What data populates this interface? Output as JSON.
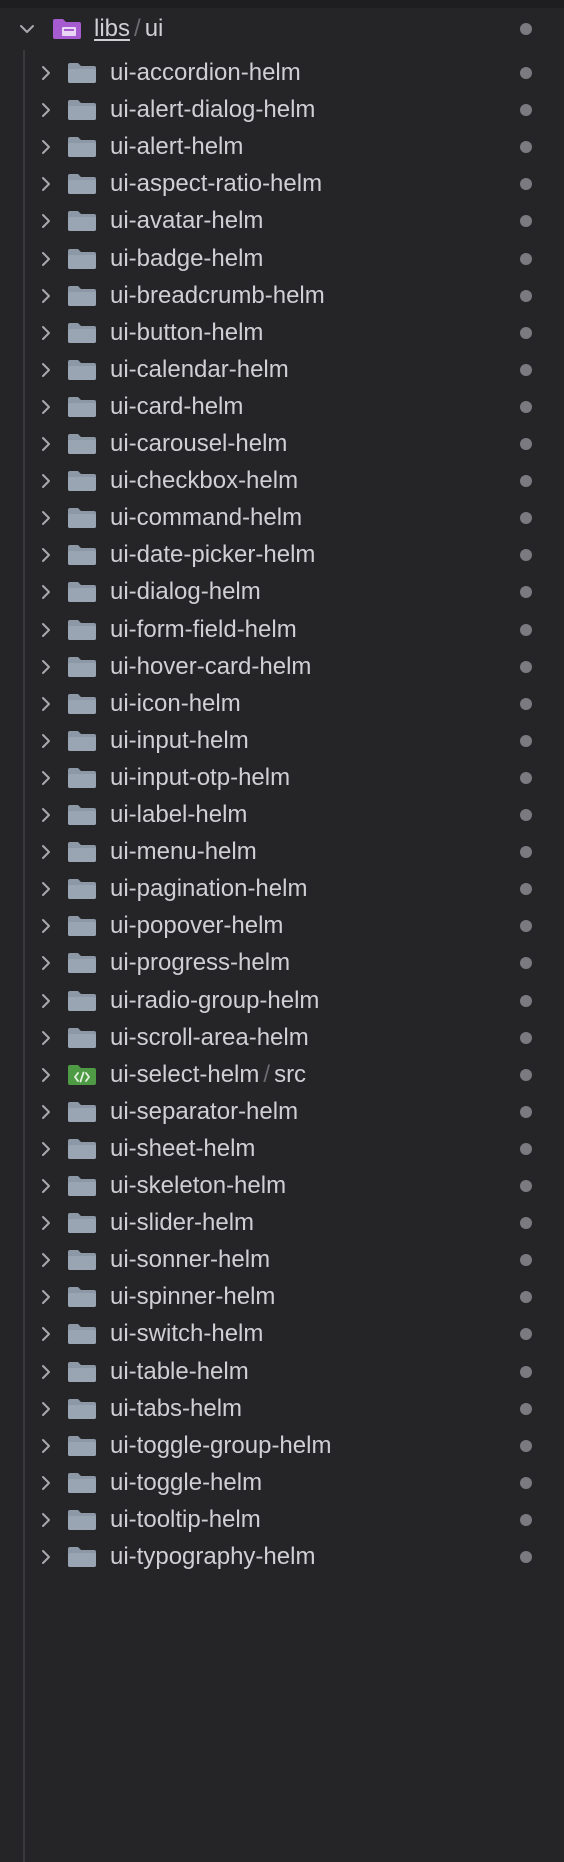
{
  "root": {
    "name": "libs",
    "subpath": "ui",
    "separator": "/",
    "expanded": true,
    "icon": "purple-folder-icon"
  },
  "items": [
    {
      "label": "ui-accordion-helm",
      "icon": "folder-icon"
    },
    {
      "label": "ui-alert-dialog-helm",
      "icon": "folder-icon"
    },
    {
      "label": "ui-alert-helm",
      "icon": "folder-icon"
    },
    {
      "label": "ui-aspect-ratio-helm",
      "icon": "folder-icon"
    },
    {
      "label": "ui-avatar-helm",
      "icon": "folder-icon"
    },
    {
      "label": "ui-badge-helm",
      "icon": "folder-icon"
    },
    {
      "label": "ui-breadcrumb-helm",
      "icon": "folder-icon"
    },
    {
      "label": "ui-button-helm",
      "icon": "folder-icon"
    },
    {
      "label": "ui-calendar-helm",
      "icon": "folder-icon"
    },
    {
      "label": "ui-card-helm",
      "icon": "folder-icon"
    },
    {
      "label": "ui-carousel-helm",
      "icon": "folder-icon"
    },
    {
      "label": "ui-checkbox-helm",
      "icon": "folder-icon"
    },
    {
      "label": "ui-command-helm",
      "icon": "folder-icon"
    },
    {
      "label": "ui-date-picker-helm",
      "icon": "folder-icon"
    },
    {
      "label": "ui-dialog-helm",
      "icon": "folder-icon"
    },
    {
      "label": "ui-form-field-helm",
      "icon": "folder-icon"
    },
    {
      "label": "ui-hover-card-helm",
      "icon": "folder-icon"
    },
    {
      "label": "ui-icon-helm",
      "icon": "folder-icon"
    },
    {
      "label": "ui-input-helm",
      "icon": "folder-icon"
    },
    {
      "label": "ui-input-otp-helm",
      "icon": "folder-icon"
    },
    {
      "label": "ui-label-helm",
      "icon": "folder-icon"
    },
    {
      "label": "ui-menu-helm",
      "icon": "folder-icon"
    },
    {
      "label": "ui-pagination-helm",
      "icon": "folder-icon"
    },
    {
      "label": "ui-popover-helm",
      "icon": "folder-icon"
    },
    {
      "label": "ui-progress-helm",
      "icon": "folder-icon"
    },
    {
      "label": "ui-radio-group-helm",
      "icon": "folder-icon"
    },
    {
      "label": "ui-scroll-area-helm",
      "icon": "folder-icon"
    },
    {
      "label": "ui-select-helm",
      "sub": "src",
      "icon": "green-code-folder-icon"
    },
    {
      "label": "ui-separator-helm",
      "icon": "folder-icon"
    },
    {
      "label": "ui-sheet-helm",
      "icon": "folder-icon"
    },
    {
      "label": "ui-skeleton-helm",
      "icon": "folder-icon"
    },
    {
      "label": "ui-slider-helm",
      "icon": "folder-icon"
    },
    {
      "label": "ui-sonner-helm",
      "icon": "folder-icon"
    },
    {
      "label": "ui-spinner-helm",
      "icon": "folder-icon"
    },
    {
      "label": "ui-switch-helm",
      "icon": "folder-icon"
    },
    {
      "label": "ui-table-helm",
      "icon": "folder-icon"
    },
    {
      "label": "ui-tabs-helm",
      "icon": "folder-icon"
    },
    {
      "label": "ui-toggle-group-helm",
      "icon": "folder-icon"
    },
    {
      "label": "ui-toggle-helm",
      "icon": "folder-icon"
    },
    {
      "label": "ui-tooltip-helm",
      "icon": "folder-icon"
    },
    {
      "label": "ui-typography-helm",
      "icon": "folder-icon"
    }
  ],
  "colors": {
    "background": "#252528",
    "text": "#cfcfd4",
    "folder": "#8d98a6",
    "root_folder": "#a65bd0",
    "code_folder": "#4f9a45",
    "status_dot": "#7a7a80",
    "chevron": "#a9a9ae"
  }
}
